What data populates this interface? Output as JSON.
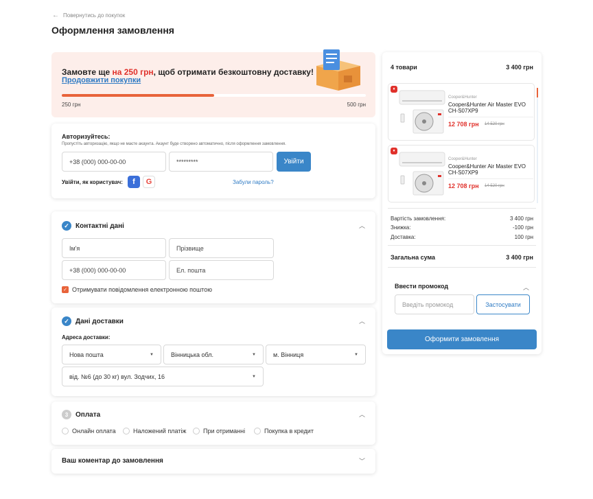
{
  "header": {
    "back_label": "Повернутись до покупок",
    "title": "Оформлення замовлення"
  },
  "banner": {
    "msg_prefix": "Замовте ще ",
    "msg_amount": "на 250 грн",
    "msg_suffix": ", щоб отримати безкоштовну доставку!",
    "link": "Продовжити покупки",
    "progress": 0.5,
    "min_label": "250 грн",
    "max_label": "500 грн"
  },
  "auth": {
    "title": "Авторизуйтесь:",
    "subtitle": "Пропустіть авторизацію, якщо не маєте акаунта. Акаунт буде створено автоматично, після оформлення замовлення.",
    "phone_placeholder": "+38 (000) 000-00-00",
    "password_value": "*********",
    "login_button": "Увійти",
    "login_as": "Увійти, як користувач:",
    "forgot": "Забули пароль?"
  },
  "contacts": {
    "title": "Контактні дані",
    "first_name": "Ім'я",
    "last_name": "Прізвище",
    "phone": "+38 (000) 000-00-00",
    "email": "Ел. пошта",
    "newsletter": "Отримувати повідомлення електронною поштою"
  },
  "delivery": {
    "title": "Дані доставки",
    "address_label": "Адреса доставки:",
    "carrier": "Нова пошта",
    "region": "Вінницька обл.",
    "city": "м. Вінниця",
    "branch": "від. №6 (до 30 кг) вул. Зодчих, 16"
  },
  "payment": {
    "step": "3",
    "title": "Оплата",
    "options": [
      "Онлайн оплата",
      "Наложений платіж",
      "При отриманні",
      "Покупка в кредит"
    ]
  },
  "comment": {
    "title": "Ваш коментар до замовлення"
  },
  "summary": {
    "count": "4 товари",
    "total": "3 400 грн",
    "products": [
      {
        "brand": "Cooper&Hunter",
        "name": "Cooper&Hunter Air Master EVO CH-S07XP9",
        "price": "12 708 грн",
        "old_price": "14 520 грн"
      },
      {
        "brand": "Cooper&Hunter",
        "name": "Cooper&Hunter Air Master EVO CH-S07XP9",
        "price": "12 708 грн",
        "old_price": "14 520 грн"
      }
    ],
    "order_cost_label": "Вартість замовлення:",
    "order_cost": "3 400 грн",
    "discount_label": "Знижка:",
    "discount": "-100 грн",
    "shipping_label": "Доставка:",
    "shipping": "100 грн",
    "grand_label": "Загальна сума",
    "grand_total": "3 400 грн",
    "promo_title": "Ввести промокод",
    "promo_placeholder": "Введіть промокод",
    "promo_apply": "Застосувати",
    "order_button": "Оформити замовлення"
  },
  "colors": {
    "accent_blue": "#3a86c8",
    "accent_orange": "#e8633a",
    "price_red": "#e0312b"
  }
}
